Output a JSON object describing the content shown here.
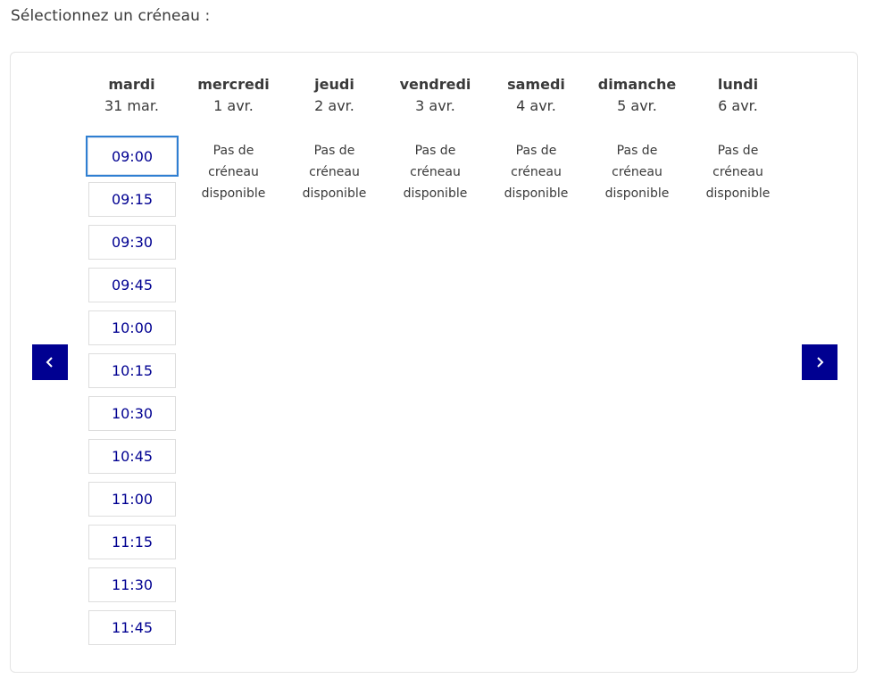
{
  "prompt": "Sélectionnez un créneau :",
  "nav": {
    "prev_icon": "chevron-left-icon",
    "next_icon": "chevron-right-icon",
    "accent_color": "#000091"
  },
  "days": [
    {
      "name": "mardi",
      "date": "31 mar."
    },
    {
      "name": "mercredi",
      "date": "1 avr.",
      "no_slot": [
        "Pas de",
        "créneau",
        "disponible"
      ]
    },
    {
      "name": "jeudi",
      "date": "2 avr.",
      "no_slot": [
        "Pas de",
        "créneau",
        "disponible"
      ]
    },
    {
      "name": "vendredi",
      "date": "3 avr.",
      "no_slot": [
        "Pas de",
        "créneau",
        "disponible"
      ]
    },
    {
      "name": "samedi",
      "date": "4 avr.",
      "no_slot": [
        "Pas de",
        "créneau",
        "disponible"
      ]
    },
    {
      "name": "dimanche",
      "date": "5 avr.",
      "no_slot": [
        "Pas de",
        "créneau",
        "disponible"
      ]
    },
    {
      "name": "lundi",
      "date": "6 avr.",
      "no_slot": [
        "Pas de",
        "créneau",
        "disponible"
      ]
    }
  ],
  "slots": [
    "09:00",
    "09:15",
    "09:30",
    "09:45",
    "10:00",
    "10:15",
    "10:30",
    "10:45",
    "11:00",
    "11:15",
    "11:30",
    "11:45"
  ],
  "selected_slot": "09:00"
}
